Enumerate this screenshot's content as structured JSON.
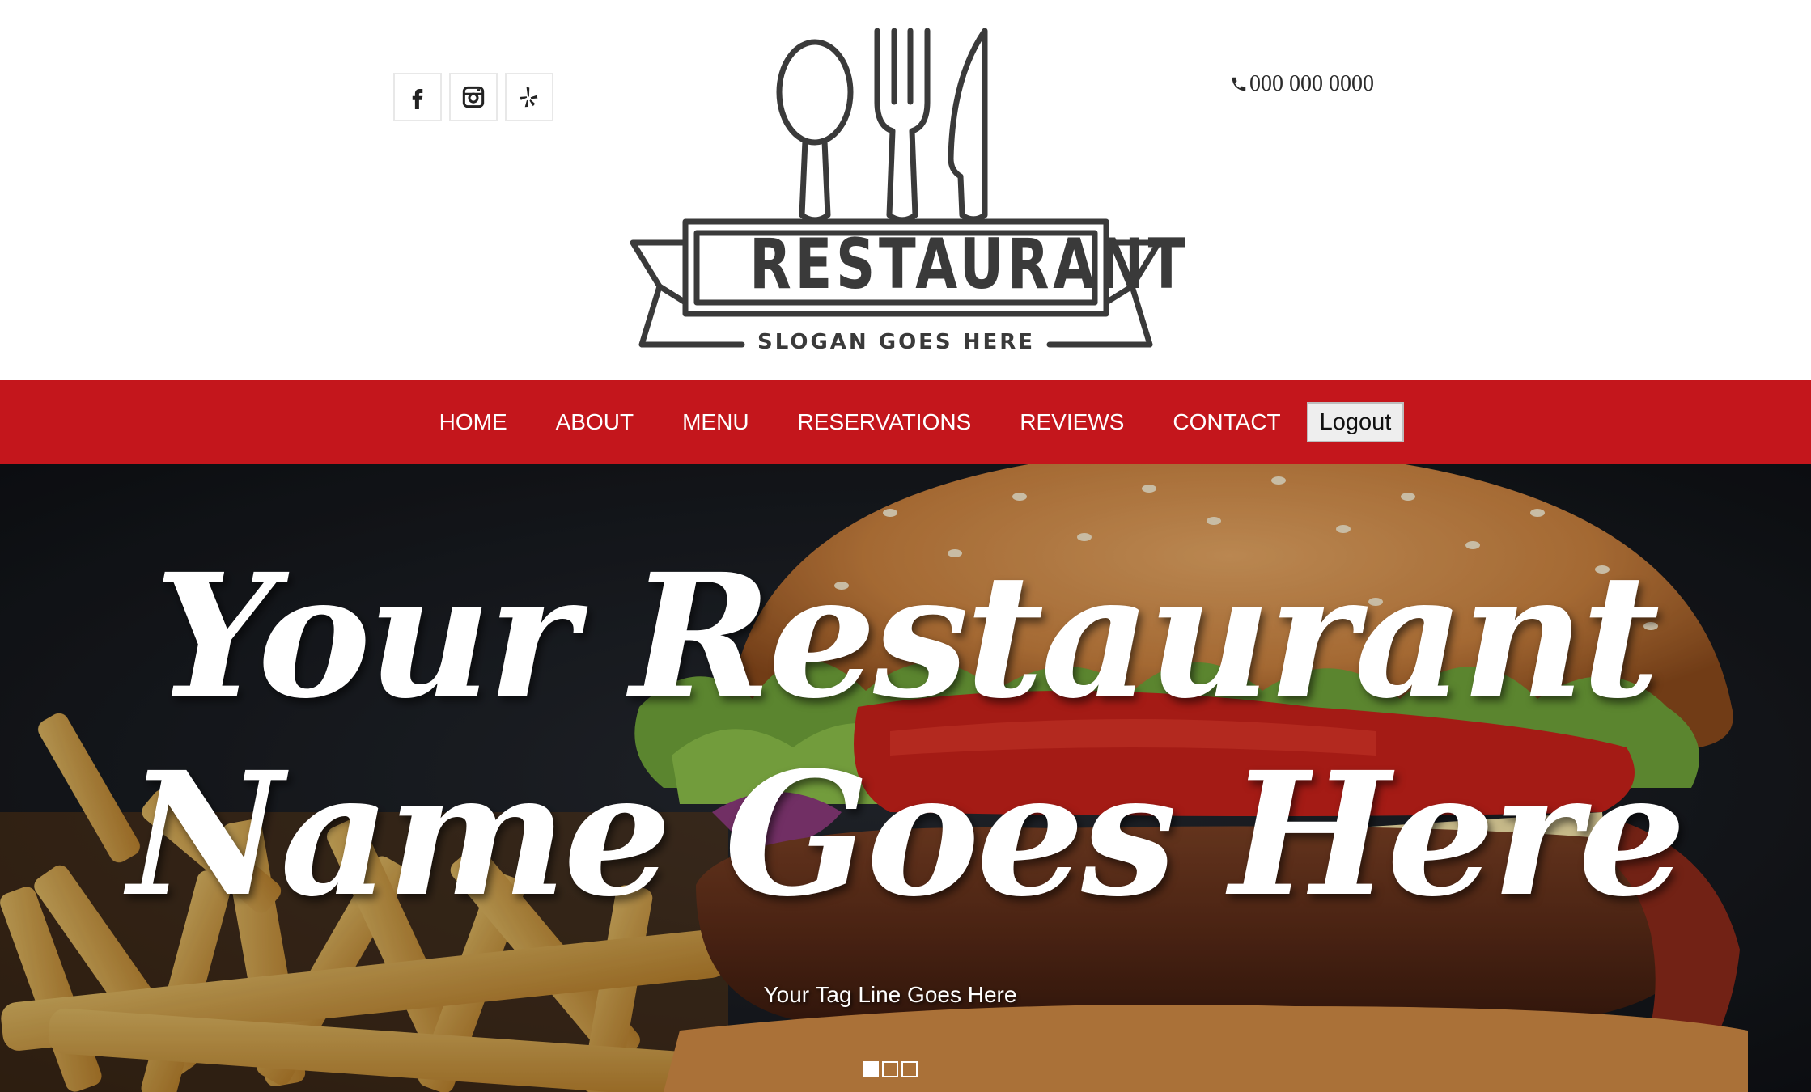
{
  "header": {
    "social": [
      {
        "name": "facebook-icon",
        "label": "Facebook"
      },
      {
        "name": "instagram-icon",
        "label": "Instagram"
      },
      {
        "name": "yelp-icon",
        "label": "Yelp"
      }
    ],
    "logo": {
      "name": "RESTAURANT",
      "slogan": "SLOGAN GOES HERE",
      "icons": [
        "spoon-icon",
        "fork-icon",
        "knife-icon"
      ]
    },
    "phone": {
      "icon": "phone-icon",
      "number": "000 000 0000"
    }
  },
  "nav": {
    "items": [
      {
        "label": "HOME"
      },
      {
        "label": "ABOUT"
      },
      {
        "label": "MENU"
      },
      {
        "label": "RESERVATIONS"
      },
      {
        "label": "REVIEWS"
      },
      {
        "label": "CONTACT"
      }
    ],
    "logout_label": "Logout"
  },
  "hero": {
    "title_line1": "Your Restaurant",
    "title_line2": "Name Goes Here",
    "tagline": "Your Tag Line Goes Here",
    "slides": {
      "count": 3,
      "active": 1
    }
  },
  "colors": {
    "brand_red": "#c4161c",
    "logo_gray": "#3a3a3a",
    "text_dark": "#2a2a2a",
    "white": "#ffffff"
  }
}
